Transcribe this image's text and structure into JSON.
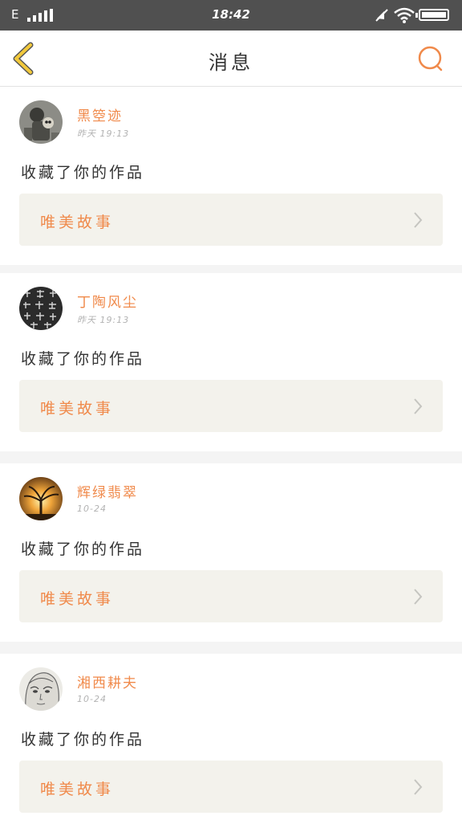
{
  "status_bar": {
    "network": "E",
    "time": "18:42"
  },
  "header": {
    "title": "消息"
  },
  "colors": {
    "accent": "#f08a4b",
    "back_arrow": "#f2c93c",
    "card_link_bg": "#f3f2ec",
    "status_bar_bg": "#505050"
  },
  "messages": [
    {
      "username": "黑箜迹",
      "time": "昨天 19:13",
      "action": "收藏了你的作品",
      "work_title": "唯美故事",
      "avatar_icon": "robot-warrior-avatar"
    },
    {
      "username": "丁陶风尘",
      "time": "昨天 19:13",
      "action": "收藏了你的作品",
      "work_title": "唯美故事",
      "avatar_icon": "calligraphy-pattern-avatar"
    },
    {
      "username": "辉绿翡翠",
      "time": "10-24",
      "action": "收藏了你的作品",
      "work_title": "唯美故事",
      "avatar_icon": "sunset-tree-avatar"
    },
    {
      "username": "湘西耕夫",
      "time": "10-24",
      "action": "收藏了你的作品",
      "work_title": "唯美故事",
      "avatar_icon": "sketch-face-avatar"
    }
  ]
}
